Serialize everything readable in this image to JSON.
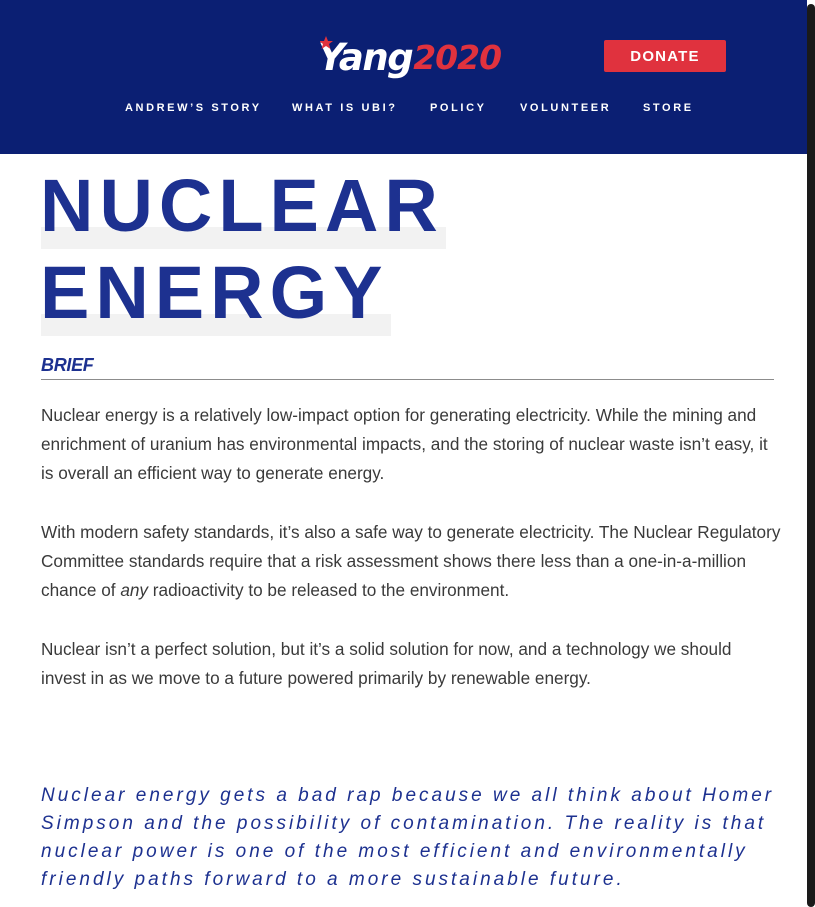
{
  "header": {
    "logo": {
      "wordmark": "Yang",
      "year": "2020"
    },
    "donate_label": "DONATE",
    "nav": [
      {
        "label": "ANDREW’S STORY"
      },
      {
        "label": "WHAT IS UBI?"
      },
      {
        "label": "POLICY"
      },
      {
        "label": "VOLUNTEER"
      },
      {
        "label": "STORE"
      }
    ]
  },
  "article": {
    "title_lines": [
      "NUCLEAR",
      "ENERGY"
    ],
    "section_heading": "BRIEF",
    "paragraph1": "Nuclear energy is a relatively low-impact option for generating electricity. While the mining and enrichment of uranium has environmental impacts, and the storing of nuclear waste isn’t easy, it is overall an efficient way to generate energy.",
    "paragraph2": {
      "before": "With modern safety standards, it’s also a safe way to generate electricity. The Nuclear Regulatory Committee standards require that a risk assessment shows there less than a one-in-a-million chance of ",
      "emphasis": "any",
      "after": " radioactivity to be released to the environment."
    },
    "paragraph3": "Nuclear isn’t a perfect solution, but it’s a solid solution for now, and a technology we should invest in as we move to a future powered primarily by renewable energy.",
    "pull_quote": "Nuclear energy gets a bad rap because we all think about Homer Simpson and the possibility of contamination. The reality is that nuclear power is one of the most efficient and environmentally friendly paths forward to a more sustainable future."
  },
  "colors": {
    "header_bg": "#0b1f73",
    "accent_red": "#e0323e",
    "title_blue": "#1d3190",
    "body_text": "#3a3a3a"
  },
  "icons": {
    "logo_mark": "star-swoosh-icon"
  }
}
